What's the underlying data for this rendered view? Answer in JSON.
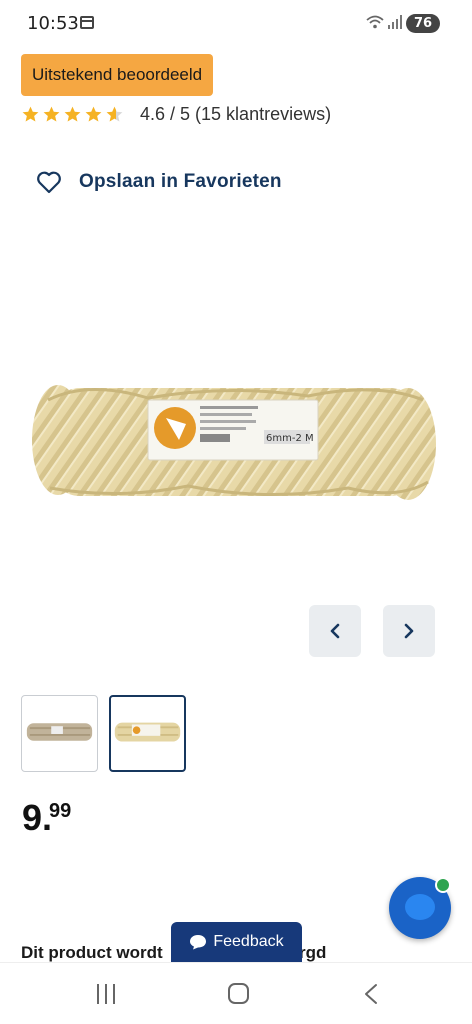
{
  "status_bar": {
    "time": "10:53",
    "battery": "76",
    "calendar_icon": "calendar-icon",
    "wifi_icon": "wifi-icon",
    "signal_icon": "signal-icon"
  },
  "badge": {
    "label": "Uitstekend beoordeeld",
    "color": "#f5a742"
  },
  "rating": {
    "stars_value": 4.6,
    "stars_max": 5,
    "text": "4.6 / 5 (15 klantreviews)",
    "star_color": "#f5b223"
  },
  "favorite": {
    "label": "Opslaan in Favorieten",
    "icon": "heart-outline-icon"
  },
  "gallery": {
    "image": "rope-coil-product-image",
    "label_text": "6mm-2 M",
    "prev_icon": "chevron-left-icon",
    "next_icon": "chevron-right-icon",
    "thumbnails": [
      {
        "name": "rope-thumbnail-dark",
        "active": false
      },
      {
        "name": "rope-thumbnail-light",
        "active": true
      }
    ]
  },
  "price": {
    "integer": "9",
    "decimal": "99"
  },
  "notice": {
    "left": "Dit product wordt",
    "right": "rgd"
  },
  "feedback": {
    "label": "Feedback",
    "icon": "chat-bubble-icon"
  },
  "chat_fab": {
    "icon": "chat-assistant-icon",
    "online_color": "#2ea44f"
  },
  "nav_bar": {
    "recent_icon": "recent-apps-icon",
    "home_icon": "home-icon",
    "back_icon": "back-icon"
  },
  "colors": {
    "primary": "#17375e",
    "feedback_bg": "#17397a",
    "nav_btn_bg": "#eaedf0"
  }
}
